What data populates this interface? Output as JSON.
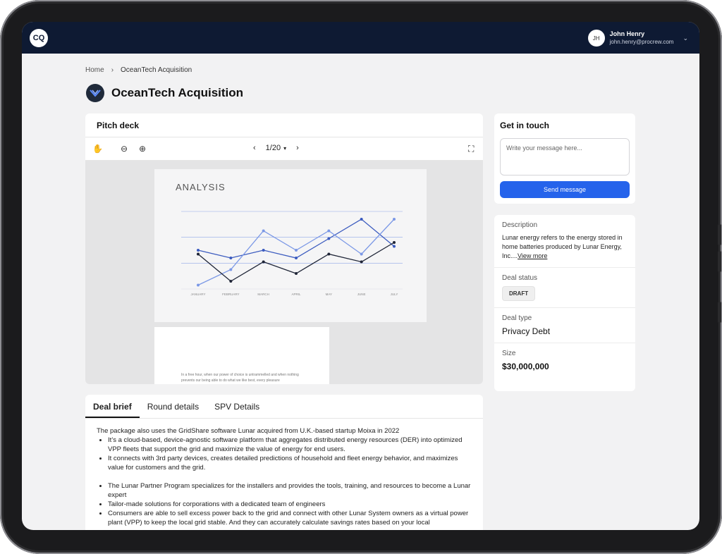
{
  "header": {
    "logo_text": "CQ",
    "user": {
      "initials": "JH",
      "name": "John Henry",
      "email": "john.henry@procrew.com"
    }
  },
  "breadcrumb": {
    "home": "Home",
    "current": "OceanTech Acquisition"
  },
  "page_title": "OceanTech Acquisition",
  "pitch_deck": {
    "title": "Pitch deck",
    "page_indicator": "1/20",
    "slide_title": "ANALYSIS",
    "slide2_text": "In a free hour, when our power of choice is untrammelled and when nothing prevents our being able to do what we like best, every pleasure"
  },
  "chart_data": {
    "type": "line",
    "title": "ANALYSIS",
    "categories": [
      "JANUARY",
      "FEBRUARY",
      "MARCH",
      "APRIL",
      "MAY",
      "JUNE",
      "JULY"
    ],
    "ylim": [
      0,
      100
    ],
    "series": [
      {
        "values": [
          50,
          40,
          50,
          40,
          65,
          90,
          55
        ],
        "color": "#3b5bbf"
      },
      {
        "values": [
          5,
          25,
          75,
          50,
          75,
          45,
          90
        ],
        "color": "#7b98e6"
      },
      {
        "values": [
          45,
          10,
          35,
          20,
          45,
          35,
          60
        ],
        "color": "#1f2537"
      }
    ]
  },
  "get_in_touch": {
    "title": "Get in touch",
    "placeholder": "Write your message here...",
    "send_label": "Send message"
  },
  "info": {
    "description_label": "Description",
    "description_text": "Lunar energy refers to the energy stored in home batteries produced by Lunar Energy, Inc....",
    "view_more": "View more",
    "deal_status_label": "Deal status",
    "deal_status": "DRAFT",
    "deal_type_label": "Deal type",
    "deal_type": "Privacy Debt",
    "size_label": "Size",
    "size": "$30,000,000"
  },
  "tabs": [
    "Deal brief",
    "Round details",
    "SPV Details"
  ],
  "brief": {
    "intro": "The package also uses the GridShare software Lunar acquired from U.K.-based startup Moixa in 2022",
    "bullets1": [
      "It’s a cloud-based, device-agnostic software platform that aggregates distributed energy resources (DER) into optimized VPP fleets that support the grid and maximize the value of energy for end users.",
      "It connects with 3rd party devices, creates detailed predictions of household and fleet energy behavior, and maximizes value for customers and the grid."
    ],
    "bullets2": [
      "The Lunar Partner Program specializes for the installers and provides the tools, training, and resources to become a Lunar expert",
      "Tailor-made solutions for corporations with a dedicated team of engineers",
      "Consumers are able to sell excess power back to the grid and connect with other Lunar System owners as a virtual power plant (VPP) to keep the local grid stable. And they can accurately calculate savings rates based on your local"
    ]
  }
}
